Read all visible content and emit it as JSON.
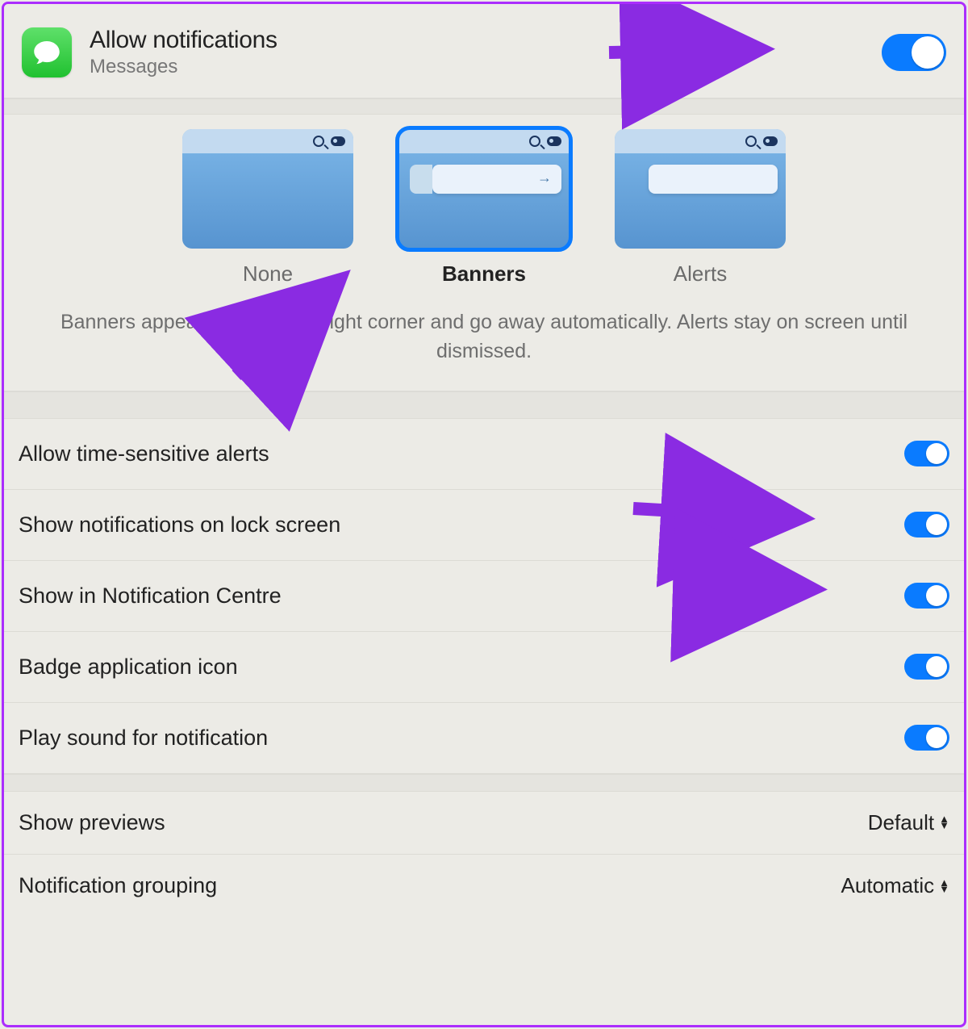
{
  "header": {
    "title": "Allow notifications",
    "subtitle": "Messages",
    "toggle_on": true
  },
  "alert_style": {
    "options": [
      {
        "id": "none",
        "label": "None",
        "selected": false,
        "thumb": "none"
      },
      {
        "id": "banners",
        "label": "Banners",
        "selected": true,
        "thumb": "banner-arrow"
      },
      {
        "id": "alerts",
        "label": "Alerts",
        "selected": false,
        "thumb": "banner"
      }
    ],
    "description": "Banners appear in the upper-right corner and go away automatically. Alerts stay on screen until dismissed."
  },
  "settings": {
    "toggles": [
      {
        "id": "time_sensitive",
        "label": "Allow time-sensitive alerts",
        "on": true
      },
      {
        "id": "lock_screen",
        "label": "Show notifications on lock screen",
        "on": true
      },
      {
        "id": "notif_centre",
        "label": "Show in Notification Centre",
        "on": true
      },
      {
        "id": "badge",
        "label": "Badge application icon",
        "on": true
      },
      {
        "id": "sound",
        "label": "Play sound for notification",
        "on": true
      }
    ],
    "selects": [
      {
        "id": "previews",
        "label": "Show previews",
        "value": "Default"
      },
      {
        "id": "grouping",
        "label": "Notification grouping",
        "value": "Automatic"
      }
    ]
  }
}
